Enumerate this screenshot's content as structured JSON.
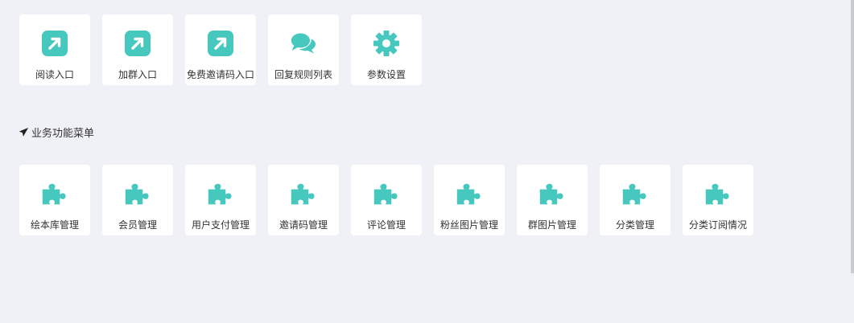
{
  "accent_color": "#46c8be",
  "quick_links": [
    {
      "label": "阅读入口",
      "icon": "external-link-icon"
    },
    {
      "label": "加群入口",
      "icon": "external-link-icon"
    },
    {
      "label": "免费邀请码入口",
      "icon": "external-link-icon"
    },
    {
      "label": "回复规则列表",
      "icon": "chat-bubbles-icon"
    },
    {
      "label": "参数设置",
      "icon": "gear-icon"
    }
  ],
  "section": {
    "title": "业务功能菜单",
    "icon": "airplane-icon"
  },
  "business_menu": [
    {
      "label": "绘本库管理",
      "icon": "puzzle-icon"
    },
    {
      "label": "会员管理",
      "icon": "puzzle-icon"
    },
    {
      "label": "用户支付管理",
      "icon": "puzzle-icon"
    },
    {
      "label": "邀请码管理",
      "icon": "puzzle-icon"
    },
    {
      "label": "评论管理",
      "icon": "puzzle-icon"
    },
    {
      "label": "粉丝图片管理",
      "icon": "puzzle-icon"
    },
    {
      "label": "群图片管理",
      "icon": "puzzle-icon"
    },
    {
      "label": "分类管理",
      "icon": "puzzle-icon"
    },
    {
      "label": "分类订阅情况",
      "icon": "puzzle-icon"
    }
  ]
}
